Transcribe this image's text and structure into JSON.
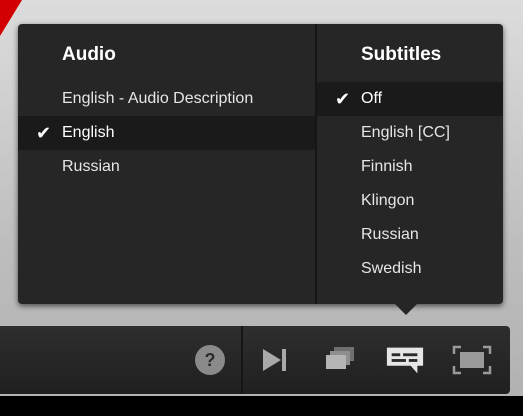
{
  "menu": {
    "audio": {
      "title": "Audio",
      "items": [
        {
          "label": "English - Audio Description",
          "selected": false
        },
        {
          "label": "English",
          "selected": true
        },
        {
          "label": "Russian",
          "selected": false
        }
      ]
    },
    "subtitles": {
      "title": "Subtitles",
      "items": [
        {
          "label": "Off",
          "selected": true
        },
        {
          "label": "English [CC]",
          "selected": false
        },
        {
          "label": "Finnish",
          "selected": false
        },
        {
          "label": "Klingon",
          "selected": false
        },
        {
          "label": "Russian",
          "selected": false
        },
        {
          "label": "Swedish",
          "selected": false
        }
      ]
    },
    "check_glyph": "✔"
  },
  "controls": {
    "help_label": "?",
    "icons": [
      "help-icon",
      "next-episode-icon",
      "episodes-icon",
      "subtitles-icon",
      "fullscreen-icon"
    ]
  },
  "colors": {
    "menu_bg": "#262626",
    "selected_row_bg": "#1a1a1a",
    "accent_bg_arrow": "#d20000"
  }
}
